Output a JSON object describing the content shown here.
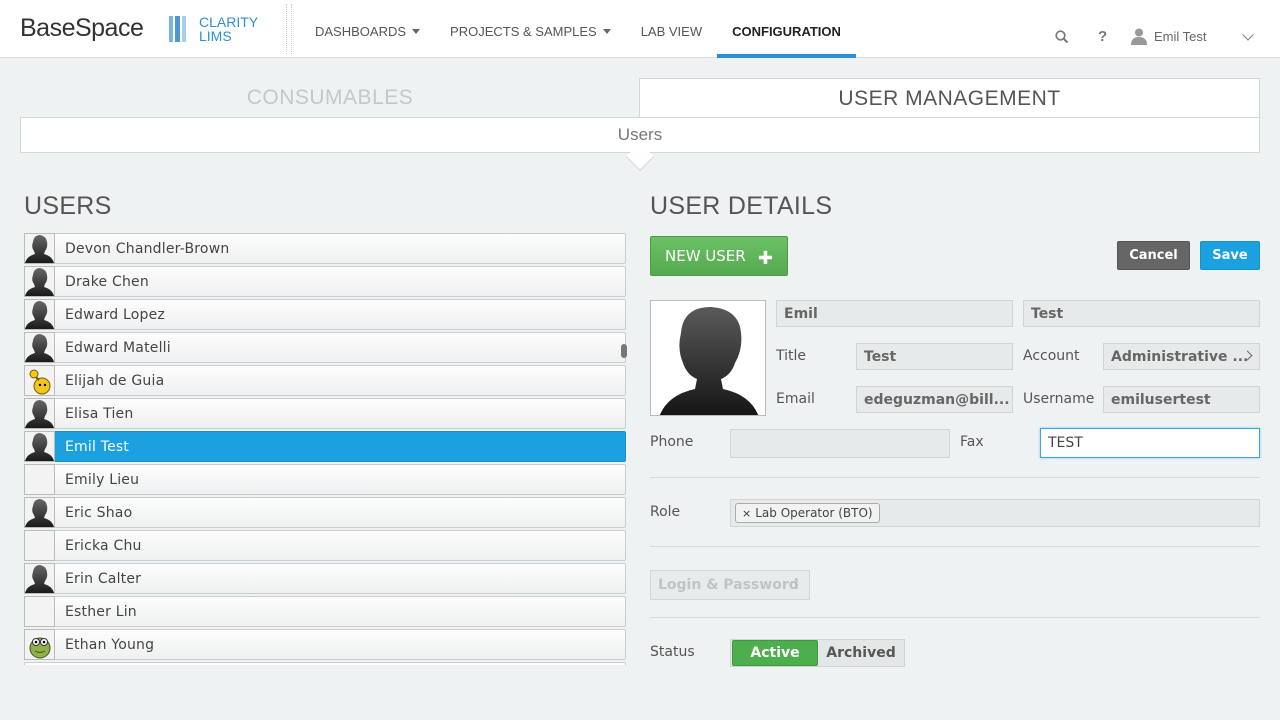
{
  "header": {
    "logo_basespace": "BaseSpace",
    "logo_clarity_line1": "CLARITY",
    "logo_clarity_line2": "LIMS",
    "nav": [
      {
        "label": "DASHBOARDS",
        "dropdown": true
      },
      {
        "label": "PROJECTS & SAMPLES",
        "dropdown": true
      },
      {
        "label": "LAB VIEW",
        "dropdown": false
      },
      {
        "label": "CONFIGURATION",
        "dropdown": false,
        "active": true
      }
    ],
    "search_icon": "search-icon",
    "help_icon": "help-icon",
    "help_glyph": "?",
    "user_name": "Emil Test",
    "accent_color": "#2d8fd5"
  },
  "tabs": {
    "consumables": "CONSUMABLES",
    "user_management": "USER MANAGEMENT",
    "subtab": "Users"
  },
  "users_panel": {
    "title": "USERS",
    "users": [
      {
        "name": "Devon Chandler-Brown",
        "avatar": "silhouette"
      },
      {
        "name": "Drake Chen",
        "avatar": "silhouette"
      },
      {
        "name": "Edward Lopez",
        "avatar": "silhouette"
      },
      {
        "name": "Edward Matelli",
        "avatar": "silhouette"
      },
      {
        "name": "Elijah de Guia",
        "avatar": "cartoon-yellow"
      },
      {
        "name": "Elisa Tien",
        "avatar": "silhouette"
      },
      {
        "name": "Emil Test",
        "avatar": "silhouette",
        "selected": true
      },
      {
        "name": "Emily Lieu",
        "avatar": "blank"
      },
      {
        "name": "Eric Shao",
        "avatar": "silhouette"
      },
      {
        "name": "Ericka Chu",
        "avatar": "blank"
      },
      {
        "name": "Erin Calter",
        "avatar": "silhouette"
      },
      {
        "name": "Esther Lin",
        "avatar": "blank"
      },
      {
        "name": "Ethan Young",
        "avatar": "cartoon-green"
      }
    ]
  },
  "details": {
    "title": "USER DETAILS",
    "new_user_label": "NEW USER",
    "new_user_plus": "✚",
    "cancel_label": "Cancel",
    "save_label": "Save",
    "first_name": "Emil",
    "last_name": "Test",
    "title_label": "Title",
    "title_value": "Test",
    "account_label": "Account",
    "account_value": "Administrative ...",
    "email_label": "Email",
    "email_value": "edeguzman@bill...",
    "username_label": "Username",
    "username_value": "emilusertest",
    "phone_label": "Phone",
    "phone_value": "",
    "fax_label": "Fax",
    "fax_value": "TEST",
    "role_label": "Role",
    "role_tag": "Lab Operator (BTO)",
    "role_tag_remove": "×",
    "login_label": "Login & Password",
    "status_label": "Status",
    "status_active": "Active",
    "status_archived": "Archived",
    "active_color": "#4cae4c",
    "save_color": "#1ba1e0"
  }
}
